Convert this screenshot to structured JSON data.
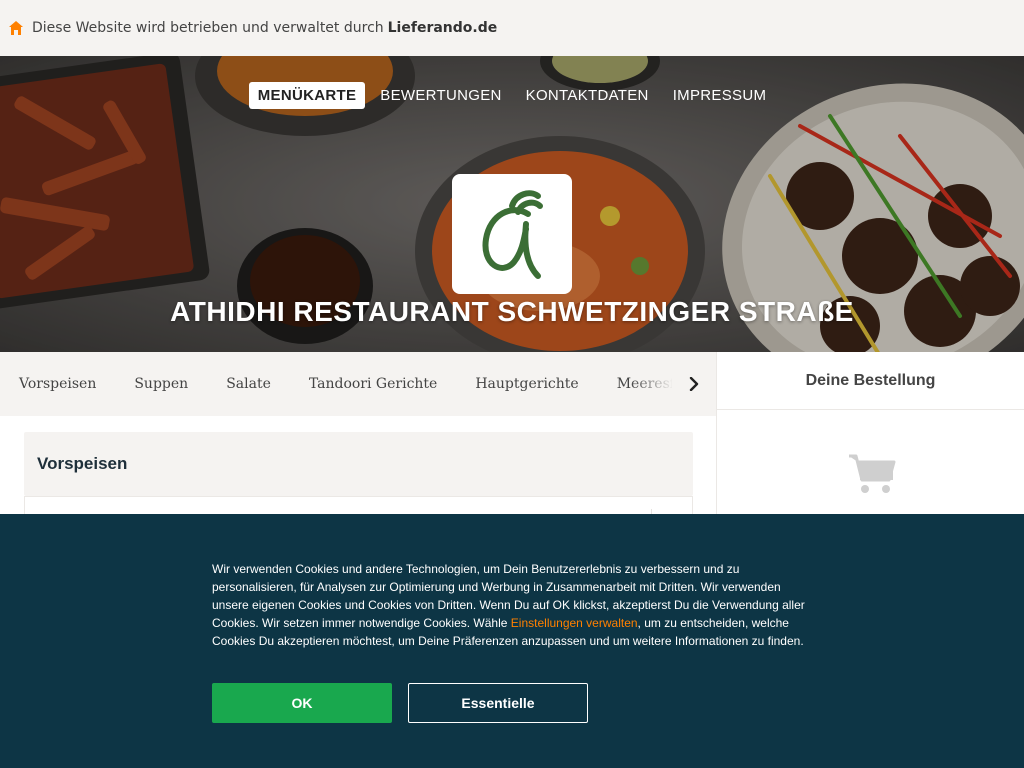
{
  "notice": {
    "text": "Diese Website wird betrieben und verwaltet durch",
    "brand": "Lieferando.de",
    "icon": "house-icon",
    "accent": "#ff8000"
  },
  "nav": {
    "items": [
      "MENÜKARTE",
      "BEWERTUNGEN",
      "KONTAKTDATEN",
      "IMPRESSUM"
    ],
    "active_index": 0
  },
  "restaurant": {
    "name": "ATHIDHI RESTAURANT SCHWETZINGER STRAßE",
    "logo_letter": "a",
    "logo_color": "#3b6e35"
  },
  "categories": [
    "Vorspeisen",
    "Suppen",
    "Salate",
    "Tandoori Gerichte",
    "Hauptgerichte",
    "Meeresfrü"
  ],
  "section": {
    "title": "Vorspeisen"
  },
  "sidebar": {
    "title": "Deine Bestellung",
    "icon": "cart-icon"
  },
  "cookie": {
    "text_before_link": "Wir verwenden Cookies und andere Technologien, um Dein Benutzererlebnis zu verbessern und zu personalisieren, für Analysen zur Optimierung und Werbung in Zusammenarbeit mit Dritten. Wir verwenden unsere eigenen Cookies und Cookies von Dritten. Wenn Du auf OK klickst, akzeptierst Du die Verwendung aller Cookies. Wir setzen immer notwendige Cookies. Wähle",
    "link": "Einstellungen verwalten",
    "text_after_link": ", um zu entscheiden, welche Cookies Du akzeptieren möchtest, um Deine Präferenzen anzupassen und um weitere Informationen zu finden.",
    "ok_label": "OK",
    "essential_label": "Essentielle",
    "bg_color": "#0d3545",
    "ok_color": "#19a84e"
  }
}
